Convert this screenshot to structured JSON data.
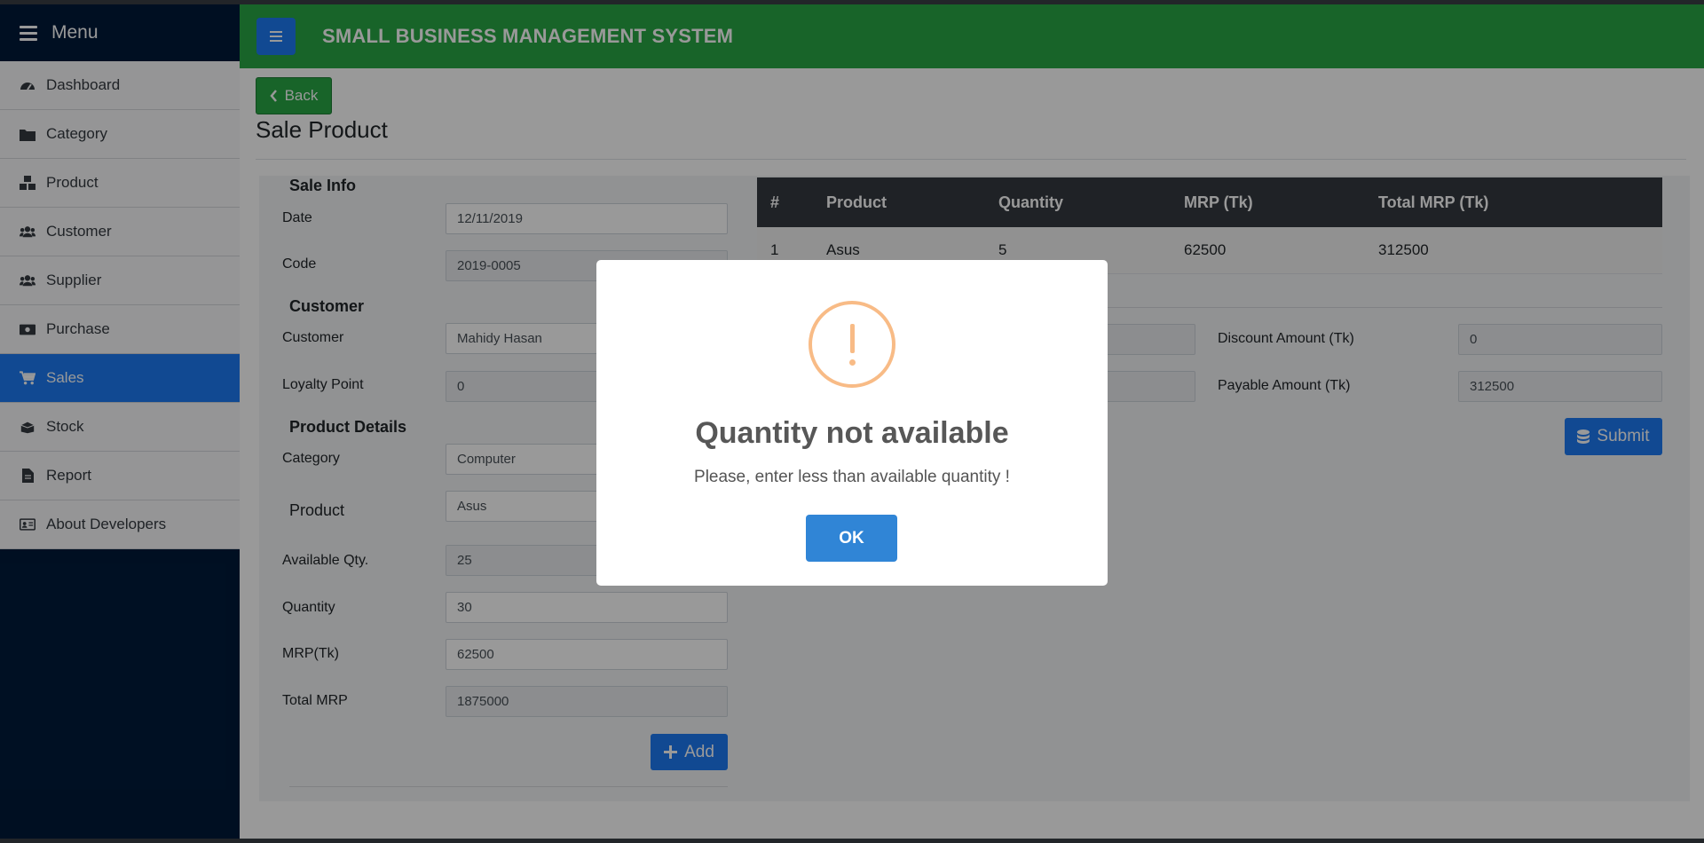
{
  "sidebar": {
    "title": "Menu",
    "items": [
      {
        "label": "Dashboard",
        "icon": "dashboard-icon"
      },
      {
        "label": "Category",
        "icon": "folder-icon"
      },
      {
        "label": "Product",
        "icon": "boxes-icon"
      },
      {
        "label": "Customer",
        "icon": "users-icon"
      },
      {
        "label": "Supplier",
        "icon": "users-icon"
      },
      {
        "label": "Purchase",
        "icon": "money-icon"
      },
      {
        "label": "Sales",
        "icon": "cart-icon",
        "active": true
      },
      {
        "label": "Stock",
        "icon": "box-open-icon"
      },
      {
        "label": "Report",
        "icon": "file-icon"
      },
      {
        "label": "About Developers",
        "icon": "id-card-icon"
      }
    ]
  },
  "header": {
    "title": "SMALL BUSINESS MANAGEMENT SYSTEM"
  },
  "page": {
    "back_label": "Back",
    "title": "Sale Product"
  },
  "sale_info": {
    "section": "Sale Info",
    "date_label": "Date",
    "date_value": "12/11/2019",
    "code_label": "Code",
    "code_value": "2019-0005"
  },
  "customer": {
    "section": "Customer",
    "customer_label": "Customer",
    "customer_value": "Mahidy Hasan",
    "loyalty_label": "Loyalty Point",
    "loyalty_value": "0"
  },
  "product_details": {
    "section": "Product Details",
    "category_label": "Category",
    "category_value": "Computer",
    "product_label": "Product",
    "product_value": "Asus",
    "available_label": "Available Qty.",
    "available_value": "25",
    "quantity_label": "Quantity",
    "quantity_value": "30",
    "mrp_label": "MRP(Tk)",
    "mrp_value": "62500",
    "total_label": "Total MRP",
    "total_value": "1875000",
    "add_label": "Add"
  },
  "table": {
    "headers": [
      "#",
      "Product",
      "Quantity",
      "MRP (Tk)",
      "Total MRP (Tk)"
    ],
    "rows": [
      [
        "1",
        "Asus",
        "5",
        "62500",
        "312500"
      ]
    ]
  },
  "summary": {
    "discount_label": "Discount Amount (Tk)",
    "discount_value": "0",
    "payable_label": "Payable Amount (Tk)",
    "payable_value": "312500",
    "submit_label": "Submit"
  },
  "modal": {
    "title": "Quantity not available",
    "text": "Please, enter less than available quantity !",
    "ok_label": "OK"
  },
  "colors": {
    "sidebar": "#001a3a",
    "header": "#28a745",
    "primary": "#1d7bf4",
    "warning": "#f8bb86",
    "ok": "#3085d6"
  }
}
